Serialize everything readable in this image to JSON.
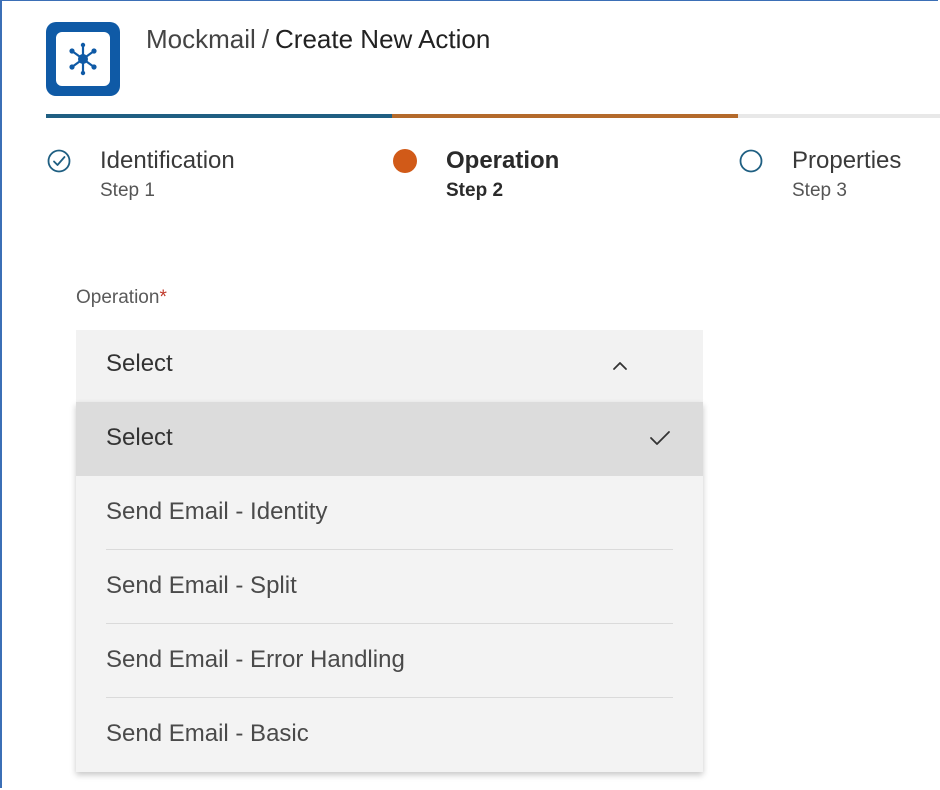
{
  "header": {
    "app_name": "Mockmail",
    "separator": "/",
    "page_title": "Create New Action",
    "logo_icon": "network-hub-icon"
  },
  "progress": {
    "completed_fraction": 0.667,
    "colors": {
      "segment_1": "#1f5f82",
      "segment_2": "#b46a2b",
      "track": "#e8e8e8"
    }
  },
  "steps": [
    {
      "title": "Identification",
      "subtitle": "Step 1",
      "state": "completed",
      "icon": "check-circle-icon"
    },
    {
      "title": "Operation",
      "subtitle": "Step 2",
      "state": "active",
      "icon": "filled-circle-icon",
      "color": "#d15a18"
    },
    {
      "title": "Properties",
      "subtitle": "Step 3",
      "state": "pending",
      "icon": "empty-circle-icon"
    }
  ],
  "field": {
    "label": "Operation",
    "required_marker": "*",
    "value": "Select",
    "chevron_icon": "chevron-up-icon"
  },
  "dropdown": {
    "options": [
      {
        "label": "Select",
        "selected": true
      },
      {
        "label": "Send Email - Identity",
        "selected": false
      },
      {
        "label": "Send Email - Split",
        "selected": false
      },
      {
        "label": "Send Email - Error Handling",
        "selected": false
      },
      {
        "label": "Send Email - Basic",
        "selected": false
      }
    ],
    "selected_icon": "checkmark-icon"
  }
}
